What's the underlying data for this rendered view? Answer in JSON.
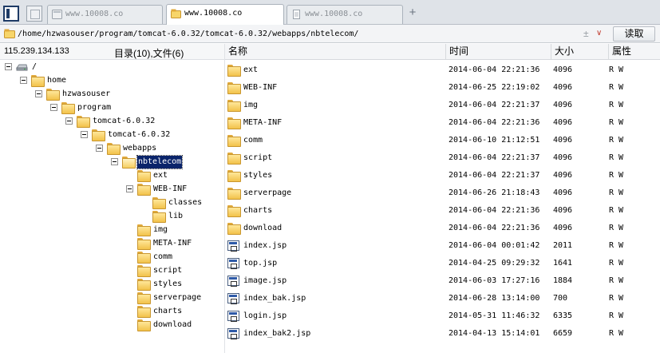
{
  "tabs": [
    {
      "title": "www.10008.co",
      "active": false
    },
    {
      "title": "www.10008.co",
      "active": true
    },
    {
      "title": "www.10008.co",
      "active": false
    }
  ],
  "address": {
    "path": "/home/hzwasouser/program/tomcat-6.0.32/tomcat-6.0.32/webapps/nbtelecom/",
    "clear_glyph": "±",
    "dropdown_glyph": "∨",
    "read_button": "读取"
  },
  "info": {
    "ip": "115.239.134.133",
    "counts": "目录(10),文件(6)"
  },
  "tree": [
    {
      "label": "/",
      "icon": "drive-icon"
    },
    {
      "label": "home",
      "icon": "folder-icon"
    },
    {
      "label": "hzwasouser",
      "icon": "folder-icon"
    },
    {
      "label": "program",
      "icon": "folder-icon"
    },
    {
      "label": "tomcat-6.0.32",
      "icon": "folder-icon"
    },
    {
      "label": "tomcat-6.0.32",
      "icon": "folder-icon"
    },
    {
      "label": "webapps",
      "icon": "folder-icon"
    },
    {
      "label": "nbtelecom",
      "icon": "folder-open-icon",
      "selected": true
    },
    {
      "label": "ext",
      "icon": "folder-icon"
    },
    {
      "label": "WEB-INF",
      "icon": "folder-icon"
    },
    {
      "label": "classes",
      "icon": "folder-icon"
    },
    {
      "label": "lib",
      "icon": "folder-icon"
    },
    {
      "label": "img",
      "icon": "folder-icon"
    },
    {
      "label": "META-INF",
      "icon": "folder-icon"
    },
    {
      "label": "comm",
      "icon": "folder-icon"
    },
    {
      "label": "script",
      "icon": "folder-icon"
    },
    {
      "label": "styles",
      "icon": "folder-icon"
    },
    {
      "label": "serverpage",
      "icon": "folder-icon"
    },
    {
      "label": "charts",
      "icon": "folder-icon"
    },
    {
      "label": "download",
      "icon": "folder-icon"
    }
  ],
  "columns": {
    "name": "名称",
    "time": "时间",
    "size": "大小",
    "attr": "属性"
  },
  "files": [
    {
      "name": "ext",
      "time": "2014-06-04 22:21:36",
      "size": "4096",
      "attr": "R W",
      "type": "folder"
    },
    {
      "name": "WEB-INF",
      "time": "2014-06-25 22:19:02",
      "size": "4096",
      "attr": "R W",
      "type": "folder"
    },
    {
      "name": "img",
      "time": "2014-06-04 22:21:37",
      "size": "4096",
      "attr": "R W",
      "type": "folder"
    },
    {
      "name": "META-INF",
      "time": "2014-06-04 22:21:36",
      "size": "4096",
      "attr": "R W",
      "type": "folder"
    },
    {
      "name": "comm",
      "time": "2014-06-10 21:12:51",
      "size": "4096",
      "attr": "R W",
      "type": "folder"
    },
    {
      "name": "script",
      "time": "2014-06-04 22:21:37",
      "size": "4096",
      "attr": "R W",
      "type": "folder"
    },
    {
      "name": "styles",
      "time": "2014-06-04 22:21:37",
      "size": "4096",
      "attr": "R W",
      "type": "folder"
    },
    {
      "name": "serverpage",
      "time": "2014-06-26 21:18:43",
      "size": "4096",
      "attr": "R W",
      "type": "folder"
    },
    {
      "name": "charts",
      "time": "2014-06-04 22:21:36",
      "size": "4096",
      "attr": "R W",
      "type": "folder"
    },
    {
      "name": "download",
      "time": "2014-06-04 22:21:36",
      "size": "4096",
      "attr": "R W",
      "type": "folder"
    },
    {
      "name": "index.jsp",
      "time": "2014-06-04 00:01:42",
      "size": "2011",
      "attr": "R W",
      "type": "jsp"
    },
    {
      "name": "top.jsp",
      "time": "2014-04-25 09:29:32",
      "size": "1641",
      "attr": "R W",
      "type": "jsp"
    },
    {
      "name": "image.jsp",
      "time": "2014-06-03 17:27:16",
      "size": "1884",
      "attr": "R W",
      "type": "jsp"
    },
    {
      "name": "index_bak.jsp",
      "time": "2014-06-28 13:14:00",
      "size": "700",
      "attr": "R W",
      "type": "jsp"
    },
    {
      "name": "login.jsp",
      "time": "2014-05-31 11:46:32",
      "size": "6335",
      "attr": "R W",
      "type": "jsp"
    },
    {
      "name": "index_bak2.jsp",
      "time": "2014-04-13 15:14:01",
      "size": "6659",
      "attr": "R W",
      "type": "jsp"
    }
  ]
}
